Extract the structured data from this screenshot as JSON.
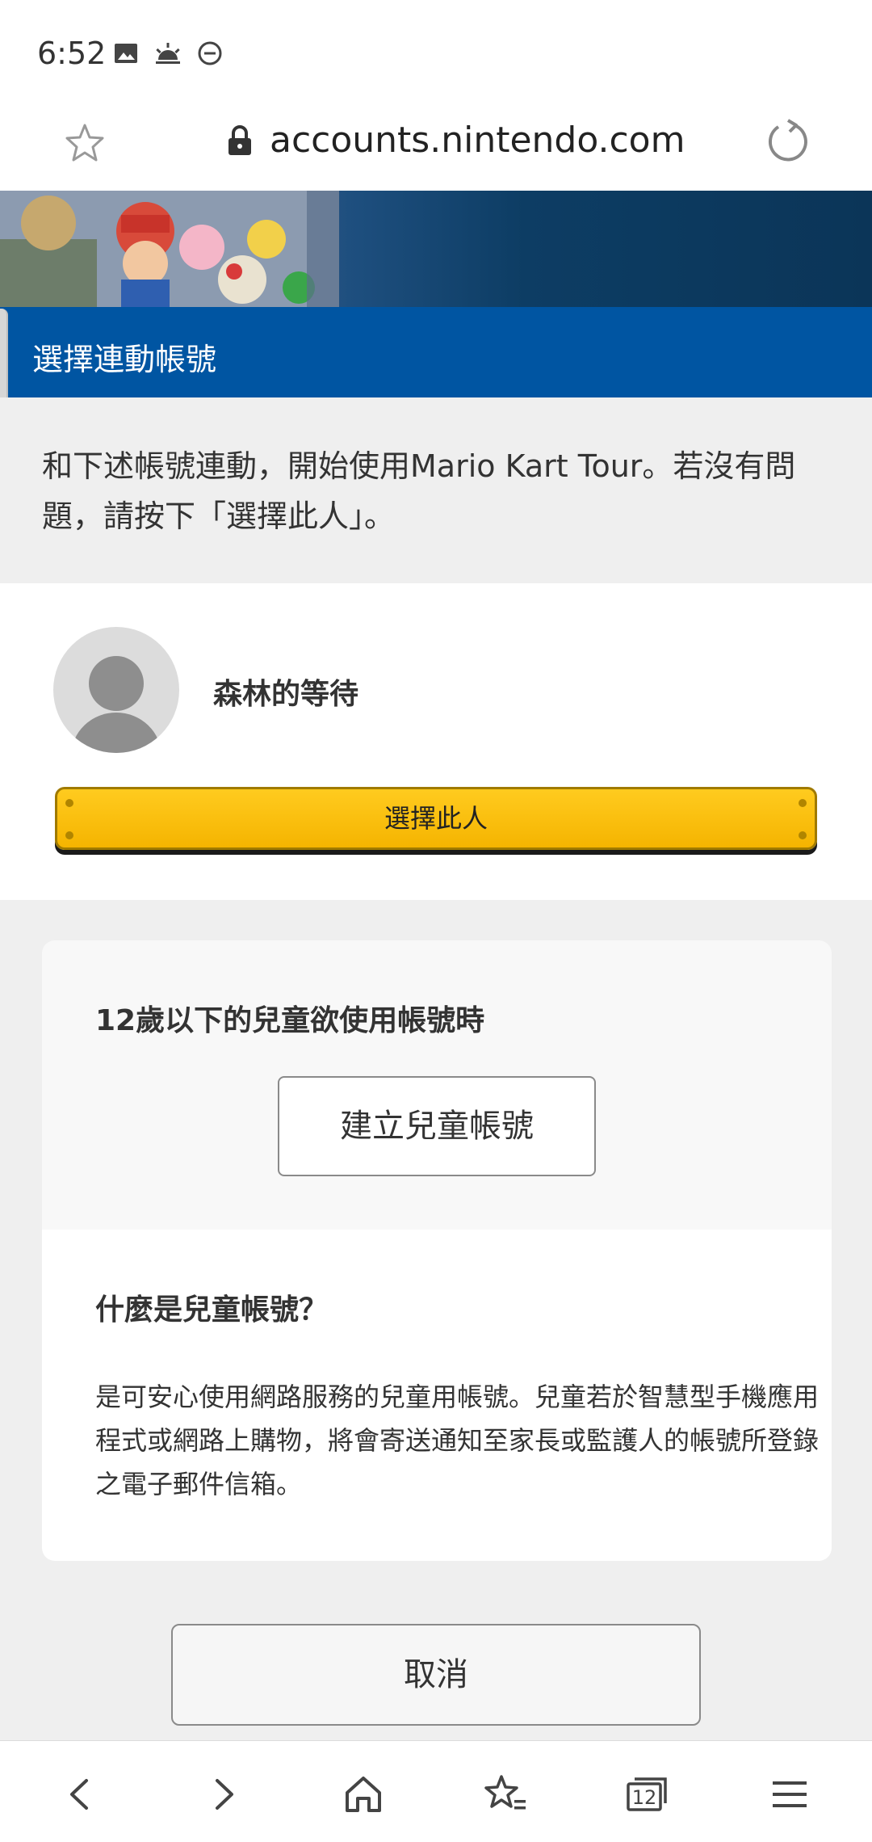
{
  "status_bar": {
    "time": "6:52",
    "icons": [
      "image-icon",
      "weather-icon",
      "do-not-disturb-icon"
    ]
  },
  "browser": {
    "url": "accounts.nintendo.com",
    "tab_count": "12"
  },
  "page": {
    "title": "選擇連動帳號",
    "intro": "和下述帳號連動，開始使用Mario Kart Tour。若沒有問題，請按下「選擇此人」。",
    "account_name": "森林的等待",
    "select_button": "選擇此人",
    "child_heading": "12歲以下的兒童欲使用帳號時",
    "create_child_button": "建立兒童帳號",
    "what_heading": "什麼是兒童帳號？",
    "what_text": "是可安心使用網路服務的兒童用帳號。兒童若於智慧型手機應用程式或網路上購物，將會寄送通知至家長或監護人的帳號所登錄之電子郵件信箱。",
    "cancel_button": "取消"
  },
  "colors": {
    "title_bar": "#0055a2",
    "select_button": "#ffc107",
    "background": "#efefef"
  }
}
